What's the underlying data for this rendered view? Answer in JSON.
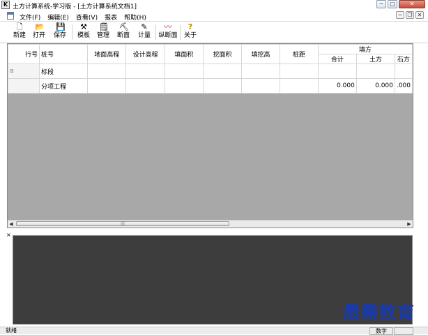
{
  "window": {
    "title": "土方计算系统-学习版 - [土方计算系统文档1]",
    "app_icon": "K",
    "minimize": "─",
    "maximize": "□",
    "close": "✕"
  },
  "menu": {
    "items": [
      "文件(F)",
      "编辑(E)",
      "查看(V)",
      "报表",
      "帮助(H)"
    ],
    "mdi_minimize": "─",
    "mdi_restore": "❐",
    "mdi_close": "✕"
  },
  "toolbar": {
    "buttons": [
      {
        "label": "新建",
        "icon": "new-file-icon",
        "glyph": "🗋"
      },
      {
        "label": "打开",
        "icon": "open-folder-icon",
        "glyph": "📂"
      },
      {
        "label": "保存",
        "icon": "save-disk-icon",
        "glyph": "💾"
      },
      {
        "label": "模板",
        "icon": "template-icon",
        "glyph": "⚒"
      },
      {
        "label": "管理",
        "icon": "manage-icon",
        "glyph": "🗒"
      },
      {
        "label": "断面",
        "icon": "section-icon",
        "glyph": "⛏"
      },
      {
        "label": "计量",
        "icon": "measure-icon",
        "glyph": "✎"
      },
      {
        "label": "纵断面",
        "icon": "profile-icon",
        "glyph": "〰"
      },
      {
        "label": "关于",
        "icon": "help-icon",
        "glyph": "?"
      }
    ]
  },
  "grid": {
    "columns": [
      "行号",
      "桩号",
      "地面高程",
      "设计高程",
      "填面积",
      "挖面积",
      "填挖高",
      "桩距"
    ],
    "group_header": "填方",
    "sub_columns": [
      "合计",
      "土方",
      "石方"
    ],
    "rows": [
      {
        "expander": "⊟",
        "station": "标段",
        "values": [
          "",
          "",
          ""
        ]
      },
      {
        "expander": "",
        "station": "分项工程",
        "values": [
          "0.000",
          "0.000",
          ".000"
        ]
      }
    ],
    "scroll_thumb": "|||",
    "scroll_left": "◀",
    "scroll_right": "▶"
  },
  "pane": {
    "close": "×"
  },
  "watermark": "最需教育",
  "status": {
    "left": "就绪",
    "right": "数字"
  },
  "colors": {
    "grid_background": "#a8a8a8",
    "output_pane": "#3d3d3d",
    "watermark": "#1a3aa8"
  }
}
